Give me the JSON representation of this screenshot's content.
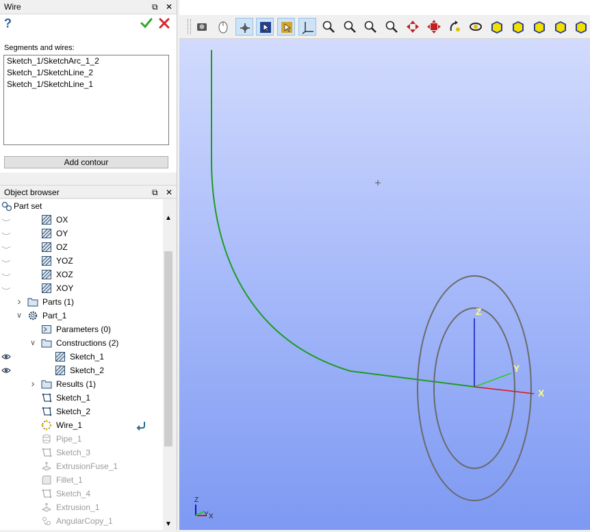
{
  "wire_panel": {
    "title": "Wire",
    "float_glyph": "⧉",
    "close_glyph": "✕",
    "help_glyph": "?",
    "segments_label": "Segments and wires:",
    "segments": [
      "Sketch_1/SketchArc_1_2",
      "Sketch_1/SketchLine_2",
      "Sketch_1/SketchLine_1"
    ],
    "add_contour": "Add contour"
  },
  "object_browser": {
    "title": "Object browser",
    "float_glyph": "⧉",
    "close_glyph": "✕",
    "root": "Part set",
    "items": [
      {
        "label": "OX",
        "icon": "plane-icon",
        "eye": "hidden",
        "arrow": "",
        "dim": false
      },
      {
        "label": "OY",
        "icon": "plane-icon",
        "eye": "hidden",
        "arrow": "",
        "dim": false
      },
      {
        "label": "OZ",
        "icon": "plane-icon",
        "eye": "hidden",
        "arrow": "",
        "dim": false
      },
      {
        "label": "YOZ",
        "icon": "plane-icon",
        "eye": "hidden",
        "arrow": "",
        "dim": false
      },
      {
        "label": "XOZ",
        "icon": "plane-icon",
        "eye": "hidden",
        "arrow": "",
        "dim": false
      },
      {
        "label": "XOY",
        "icon": "plane-icon",
        "eye": "hidden",
        "arrow": "",
        "dim": false
      },
      {
        "label": "Parts (1)",
        "icon": "folder-icon",
        "eye": "",
        "arrow": "right",
        "dim": false
      },
      {
        "label": "Part_1",
        "icon": "gear-icon",
        "eye": "",
        "arrow": "down",
        "dim": false
      },
      {
        "label": "Parameters (0)",
        "icon": "parameters-icon",
        "eye": "",
        "arrow": "",
        "dim": false
      },
      {
        "label": "Constructions (2)",
        "icon": "folder-icon",
        "eye": "",
        "arrow": "down",
        "dim": false
      },
      {
        "label": "Sketch_1",
        "icon": "plane-icon",
        "eye": "visible",
        "arrow": "",
        "dim": false
      },
      {
        "label": "Sketch_2",
        "icon": "plane-icon",
        "eye": "visible",
        "arrow": "",
        "dim": false
      },
      {
        "label": "Results (1)",
        "icon": "folder-icon",
        "eye": "",
        "arrow": "right",
        "dim": false
      },
      {
        "label": "Sketch_1",
        "icon": "sketch-icon",
        "eye": "",
        "arrow": "",
        "dim": false
      },
      {
        "label": "Sketch_2",
        "icon": "sketch-icon",
        "eye": "",
        "arrow": "",
        "dim": false
      },
      {
        "label": "Wire_1",
        "icon": "wire-icon",
        "eye": "",
        "arrow": "",
        "dim": false
      },
      {
        "label": "Pipe_1",
        "icon": "pipe-icon",
        "eye": "",
        "arrow": "",
        "dim": true
      },
      {
        "label": "Sketch_3",
        "icon": "sketch-icon",
        "eye": "",
        "arrow": "",
        "dim": true
      },
      {
        "label": "ExtrusionFuse_1",
        "icon": "extrusion-fuse-icon",
        "eye": "",
        "arrow": "",
        "dim": true
      },
      {
        "label": "Fillet_1",
        "icon": "fillet-icon",
        "eye": "",
        "arrow": "",
        "dim": true
      },
      {
        "label": "Sketch_4",
        "icon": "sketch-icon",
        "eye": "",
        "arrow": "",
        "dim": true
      },
      {
        "label": "Extrusion_1",
        "icon": "extrusion-icon",
        "eye": "",
        "arrow": "",
        "dim": true
      },
      {
        "label": "AngularCopy_1",
        "icon": "angular-copy-icon",
        "eye": "",
        "arrow": "",
        "dim": true
      }
    ]
  },
  "toolbar": {
    "buttons": [
      {
        "name": "dump-view-icon",
        "active": false
      },
      {
        "name": "mouse-icon",
        "active": false
      },
      {
        "name": "trihedron-icon",
        "active": true
      },
      {
        "name": "select-icon",
        "active": true
      },
      {
        "name": "select-shape-icon",
        "active": true
      },
      {
        "name": "axes-icon",
        "active": true
      },
      {
        "name": "fit-all-icon",
        "active": false
      },
      {
        "name": "fit-area-icon",
        "active": false
      },
      {
        "name": "fit-selection-icon",
        "active": false
      },
      {
        "name": "zoom-icon",
        "active": false
      },
      {
        "name": "pan-icon",
        "active": false
      },
      {
        "name": "global-pan-icon",
        "active": false
      },
      {
        "name": "rotate-icon",
        "active": false
      },
      {
        "name": "rotation-point-icon",
        "active": false
      },
      {
        "name": "front-view-icon",
        "active": false
      },
      {
        "name": "back-view-icon",
        "active": false
      },
      {
        "name": "top-view-icon",
        "active": false
      },
      {
        "name": "bottom-view-icon",
        "active": false
      },
      {
        "name": "left-view-icon",
        "active": false
      },
      {
        "name": "right-view-icon",
        "active": false
      }
    ]
  },
  "viewport": {
    "axis_labels": {
      "x": "X",
      "y": "Y",
      "z": "Z"
    },
    "corner_labels": {
      "x": "X",
      "y": "Y",
      "z": "Z"
    },
    "colors": {
      "wire": "#1f9a1f",
      "x_axis": "#e0101a",
      "y_axis": "#1fd01f",
      "z_axis": "#1010c0",
      "circles": "#6a6a6a"
    }
  }
}
